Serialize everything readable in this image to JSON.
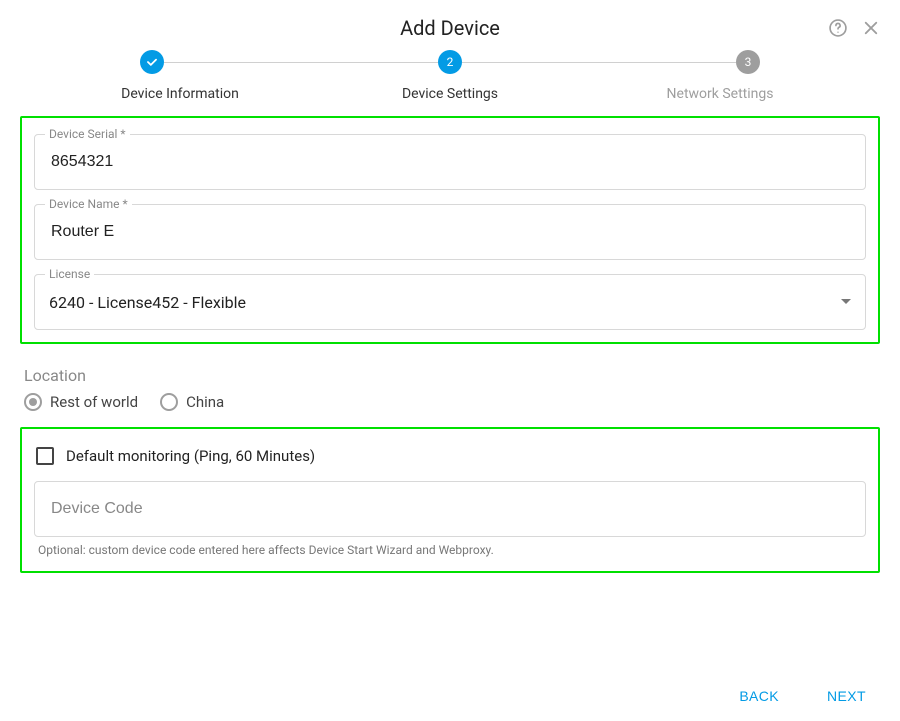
{
  "title": "Add Device",
  "steps": {
    "s1_label": "Device Information",
    "s2_label": "Device Settings",
    "s3_label": "Network Settings",
    "s2_num": "2",
    "s3_num": "3"
  },
  "fields": {
    "serial_label": "Device Serial *",
    "serial_value": "8654321",
    "name_label": "Device Name *",
    "name_value": "Router E",
    "license_label": "License",
    "license_value": "6240 - License452 - Flexible"
  },
  "location": {
    "label": "Location",
    "opt1": "Rest of world",
    "opt2": "China"
  },
  "monitoring": {
    "label": "Default monitoring (Ping, 60 Minutes)"
  },
  "device_code": {
    "placeholder": "Device Code",
    "helper": "Optional: custom device code entered here affects Device Start Wizard and Webproxy."
  },
  "footer": {
    "back": "BACK",
    "next": "NEXT"
  }
}
